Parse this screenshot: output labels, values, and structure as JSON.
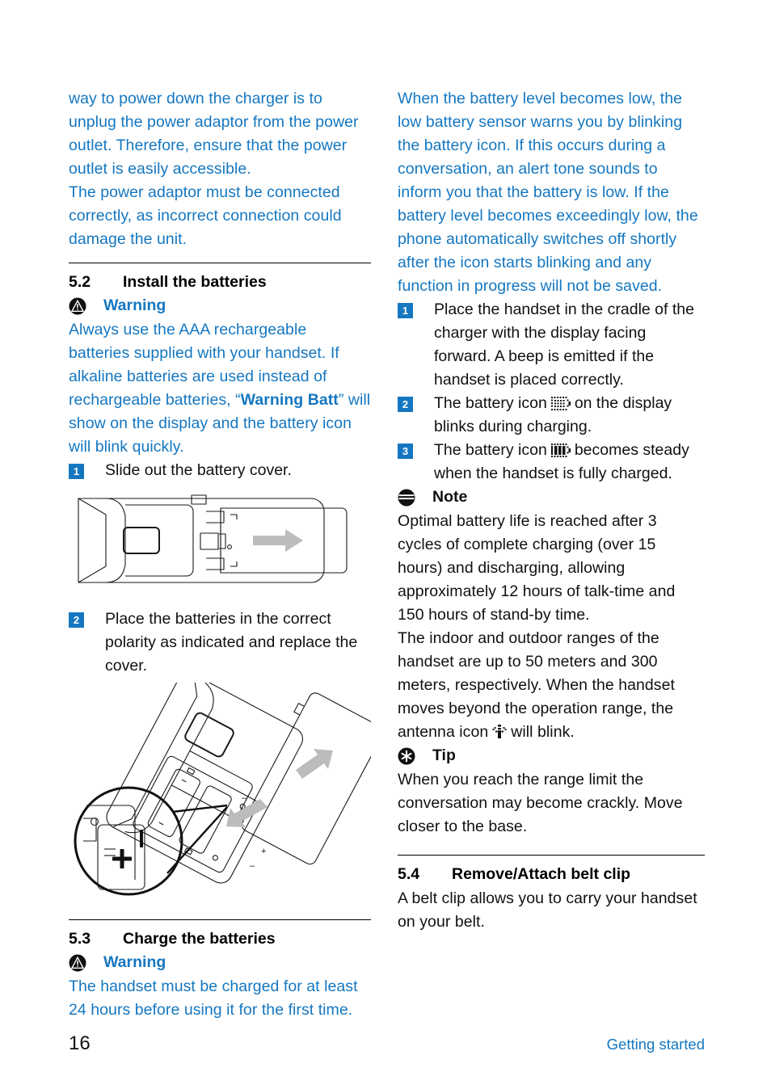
{
  "document": {
    "page_number": "16",
    "footer_section": "Getting started",
    "accent_blue": "#1577c0",
    "body_black": "#111111"
  },
  "left_column": {
    "intro_paragraphs": [
      "way to power down the charger is to unplug the power adaptor from the power outlet. Therefore, ensure that the power outlet is easily accessible.",
      "The power adaptor must be connected correctly, as incorrect connection could damage the unit."
    ],
    "section_5_2": {
      "number": "5.2",
      "title": "Install the batteries",
      "warning": {
        "icon": "warning-triangle-icon",
        "label": "Warning",
        "text_before": "Always use the AAA rechargeable batteries supplied with your handset. If alkaline batteries are used instead of rechargeable batteries, “",
        "text_bold": "Warning Batt",
        "text_after": "” will show on the display and the battery icon will blink quickly."
      },
      "steps": [
        {
          "num": "1",
          "text": "Slide out the battery cover."
        },
        {
          "num": "2",
          "text": "Place the batteries in the correct polarity as indicated and replace the cover."
        }
      ],
      "figure_1_caption": "handset-back-with-sliding-battery-cover",
      "figure_2_caption": "handset-battery-compartment-polarity-detail"
    },
    "section_5_3": {
      "number": "5.3",
      "title": "Charge the batteries",
      "warning": {
        "icon": "warning-triangle-icon",
        "label": "Warning",
        "text": "The handset must be charged for at least 24 hours before using it for the first time."
      }
    }
  },
  "right_column": {
    "battery_low_paragraph": "When the battery level becomes low, the low battery sensor warns you by blinking the battery icon. If this occurs during a conversation, an alert tone sounds to inform you that the battery is low. If the battery level becomes exceedingly low, the phone automatically switches off shortly after the icon starts blinking and any function in progress will not be saved.",
    "charging_steps": [
      {
        "num": "1",
        "text_parts": [
          "Place the handset in the cradle of the charger with the display facing forward. A beep is emitted if the handset is placed correctly."
        ],
        "icon": null
      },
      {
        "num": "2",
        "text_before": "The battery icon",
        "icon": "battery-charging-icon",
        "text_after": "on the display blinks during charging."
      },
      {
        "num": "3",
        "text_before": "The battery icon",
        "icon": "battery-full-icon",
        "text_after": "becomes steady when the handset is fully charged."
      }
    ],
    "note": {
      "icon": "note-icon",
      "label": "Note",
      "paragraph_1": "Optimal battery life is reached after 3 cycles of complete charging (over 15 hours) and discharging, allowing approximately 12 hours of talk-time and 150 hours of stand-by time.",
      "paragraph_2_before": "The indoor and outdoor ranges of the handset are up to 50 meters and 300 meters, respectively. When the handset moves beyond the operation range, the antenna icon",
      "paragraph_2_icon": "antenna-icon",
      "paragraph_2_after": "will blink."
    },
    "tip": {
      "icon": "tip-asterisk-icon",
      "label": "Tip",
      "text": "When you reach the range limit the conversation may become crackly. Move closer to the base."
    },
    "section_5_4": {
      "number": "5.4",
      "title": "Remove/Attach belt clip",
      "text": "A belt clip allows you to carry your handset on your belt."
    }
  }
}
